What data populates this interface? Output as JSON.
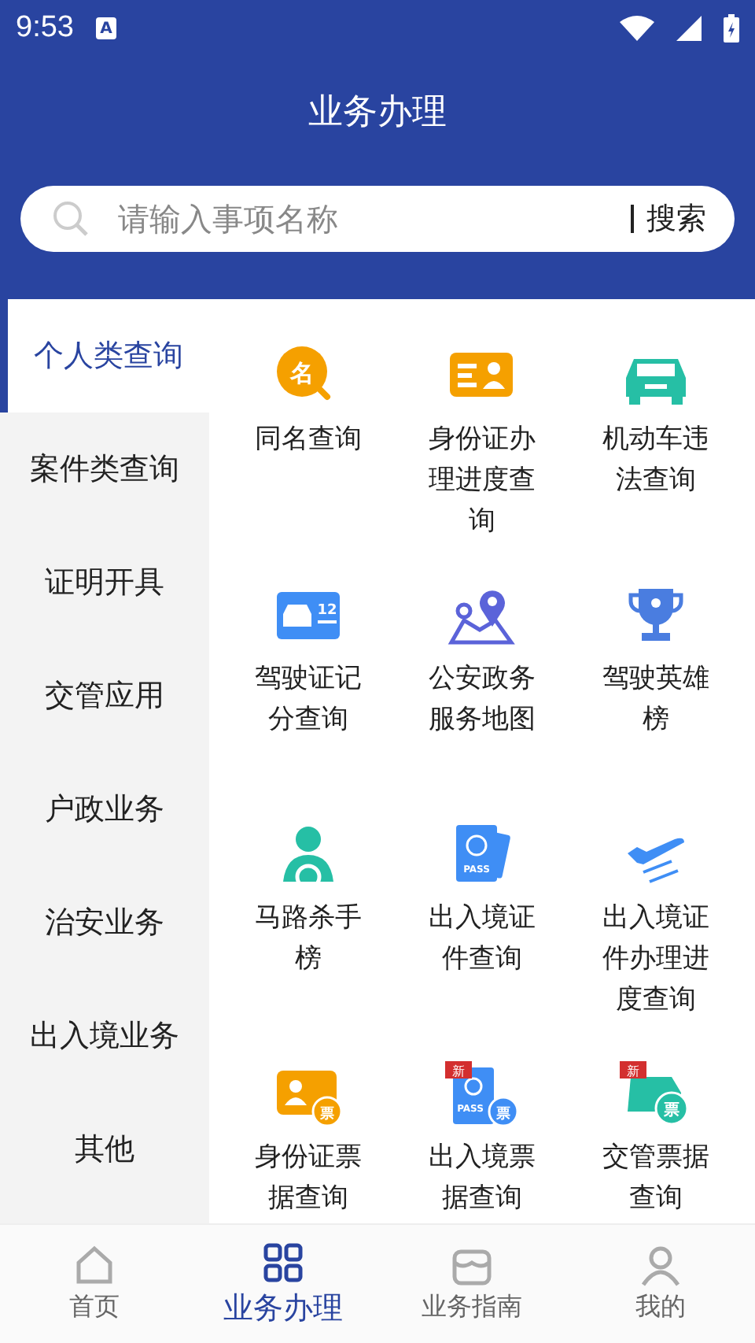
{
  "status_bar": {
    "time": "9:53",
    "notice_glyph": "A"
  },
  "header": {
    "title": "业务办理"
  },
  "search": {
    "placeholder": "请输入事项名称",
    "button": "搜索"
  },
  "sidebar": {
    "items": [
      {
        "label": "个人类查询",
        "selected": true
      },
      {
        "label": "案件类查询",
        "selected": false
      },
      {
        "label": "证明开具",
        "selected": false
      },
      {
        "label": "交管应用",
        "selected": false
      },
      {
        "label": "户政业务",
        "selected": false
      },
      {
        "label": "治安业务",
        "selected": false
      },
      {
        "label": "出入境业务",
        "selected": false
      },
      {
        "label": "其他",
        "selected": false
      }
    ]
  },
  "services": [
    {
      "label": "同名查询",
      "icon_texts": [
        "名"
      ]
    },
    {
      "label": "身份证办理进度查询"
    },
    {
      "label": "机动车违法查询"
    },
    {
      "label": "驾驶证记分查询",
      "icon_texts": [
        "12"
      ]
    },
    {
      "label": "公安政务服务地图"
    },
    {
      "label": "驾驶英雄榜"
    },
    {
      "label": "马路杀手榜"
    },
    {
      "label": "出入境证件查询",
      "icon_texts": [
        "PASS"
      ]
    },
    {
      "label": "出入境证件办理进度查询"
    },
    {
      "label": "身份证票据查询",
      "icon_texts": [
        "票"
      ]
    },
    {
      "label": "出入境票据查询",
      "icon_texts": [
        "PASS",
        "票"
      ],
      "new_tag": "新"
    },
    {
      "label": "交管票据查询",
      "icon_texts": [
        "票"
      ],
      "new_tag": "新"
    }
  ],
  "tab_bar": [
    {
      "label": "首页",
      "selected": false
    },
    {
      "label": "业务办理",
      "selected": true
    },
    {
      "label": "业务指南",
      "selected": false
    },
    {
      "label": "我的",
      "selected": false
    }
  ]
}
